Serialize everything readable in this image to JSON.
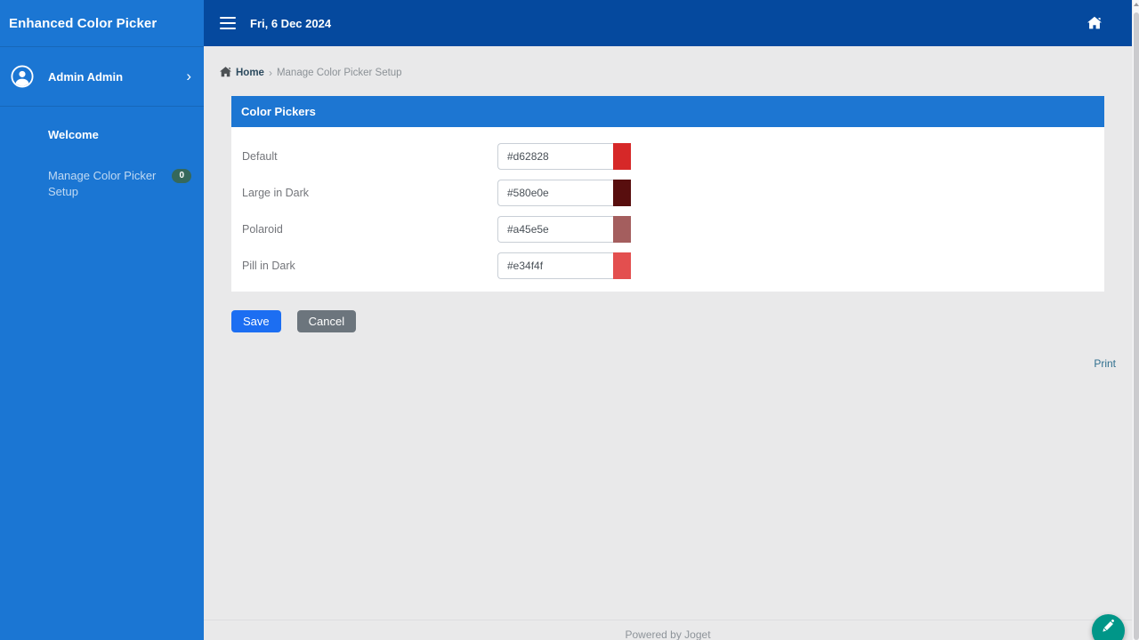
{
  "app": {
    "title": "Enhanced Color Picker"
  },
  "sidebar": {
    "user": {
      "name": "Admin Admin"
    },
    "menu": [
      {
        "label": "Welcome"
      },
      {
        "label": "Manage Color Picker Setup",
        "badge": "0"
      }
    ]
  },
  "topbar": {
    "date": "Fri, 6 Dec 2024"
  },
  "breadcrumb": {
    "home": "Home",
    "separator": "›",
    "current": "Manage Color Picker Setup"
  },
  "panel": {
    "title": "Color Pickers",
    "fields": [
      {
        "label": "Default",
        "value": "#d62828",
        "swatch": "#d62828"
      },
      {
        "label": "Large in Dark",
        "value": "#580e0e",
        "swatch": "#580e0e"
      },
      {
        "label": "Polaroid",
        "value": "#a45e5e",
        "swatch": "#a45e5e"
      },
      {
        "label": "Pill in Dark",
        "value": "#e34f4f",
        "swatch": "#e34f4f"
      }
    ]
  },
  "actions": {
    "save": "Save",
    "cancel": "Cancel"
  },
  "links": {
    "print": "Print"
  },
  "footer": {
    "text": "Powered by Joget"
  },
  "icons": {
    "chevron_right": "›"
  },
  "colors": {
    "sidebar": "#1b76d3",
    "topbar": "#05499e",
    "panel_header": "#1d76d2",
    "save_button": "#1c6ef2",
    "cancel_button": "#6c757d",
    "badge": "#35685b",
    "fab": "#009688",
    "print_link": "#31708f"
  }
}
